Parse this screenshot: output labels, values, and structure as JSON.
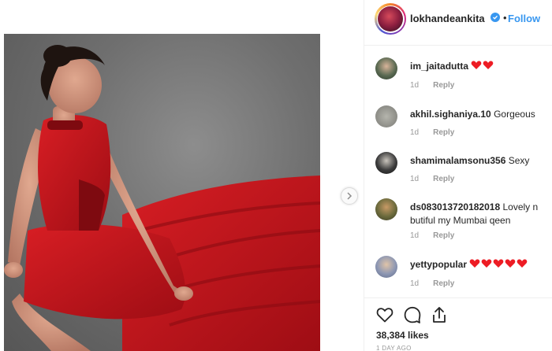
{
  "post": {
    "username": "lokhandeankita",
    "separator": "•",
    "follow_label": "Follow",
    "next_icon": "chevron-right-icon",
    "verified_icon": "verified-check-icon"
  },
  "comments": [
    {
      "user": "im_jaitadutta",
      "text": "",
      "hearts": 2,
      "age": "1d",
      "reply": "Reply",
      "avatar_color": "#3b4a3a"
    },
    {
      "user": "akhil.sighaniya.10",
      "text": "Gorgeous",
      "hearts": 0,
      "age": "1d",
      "reply": "Reply",
      "avatar_color": "#9a9a94"
    },
    {
      "user": "shamimalamsonu356",
      "text": "Sexy",
      "hearts": 0,
      "age": "1d",
      "reply": "Reply",
      "avatar_color": "#2a2a2a"
    },
    {
      "user": "ds083013720182018",
      "text": "Lovely n butiful my Mumbai qeen",
      "hearts": 0,
      "age": "1d",
      "reply": "Reply",
      "avatar_color": "#5d5a3a"
    },
    {
      "user": "yettypopular",
      "text": "",
      "hearts": 5,
      "age": "1d",
      "reply": "Reply",
      "avatar_color": "#7e8ba8"
    }
  ],
  "actions": {
    "like_icon": "heart-outline-icon",
    "comment_icon": "comment-bubble-icon",
    "share_icon": "share-upload-icon"
  },
  "likes_text": "38,384 likes",
  "time_text": "1 DAY AGO",
  "colors": {
    "accent": "#3897f0",
    "heart": "#ed1c24",
    "dress": "#c8161d"
  }
}
